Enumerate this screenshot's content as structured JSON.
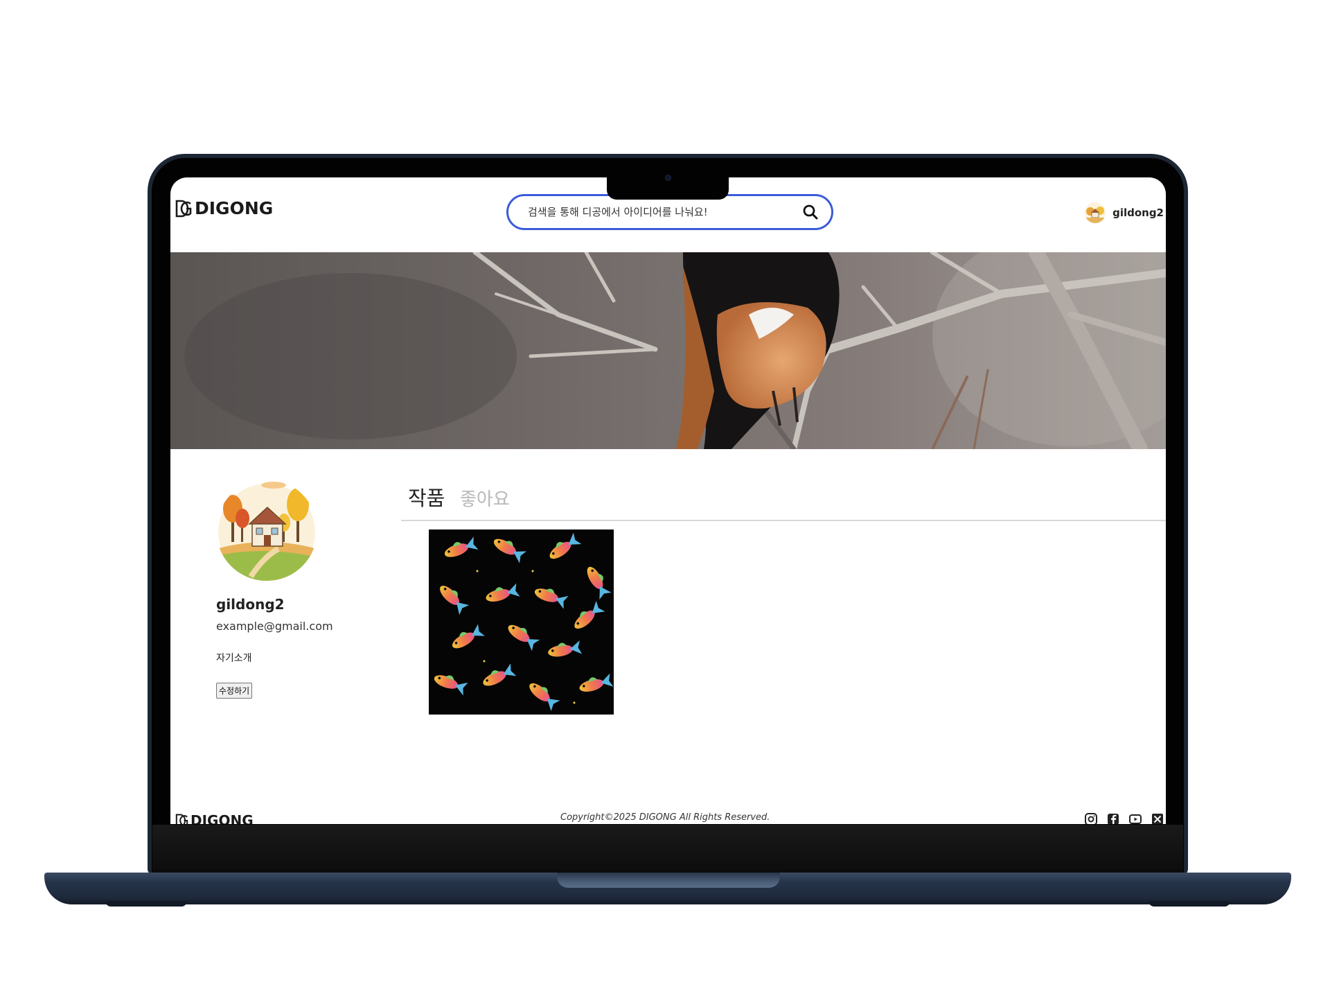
{
  "header": {
    "logo_text": "DIGONG",
    "search_placeholder": "검색을 통해 디공에서 아이디어를 나눠요!",
    "username": "gildong2"
  },
  "profile": {
    "name": "gildong2",
    "email": "example@gmail.com",
    "bio": "자기소개",
    "edit_label": "수정하기"
  },
  "tabs": [
    {
      "label": "작품",
      "active": true
    },
    {
      "label": "좋아요",
      "active": false
    }
  ],
  "footer": {
    "logo_text": "DIGONG",
    "copyright": "Copyright©2025 DIGONG All Rights Reserved.",
    "social_icons": [
      "instagram-icon",
      "facebook-icon",
      "youtube-icon",
      "x-icon"
    ]
  },
  "colors": {
    "search_border": "#3a5bd9",
    "tab_active": "#222222",
    "tab_inactive": "#b8b8b8",
    "laptop_body": "#1c2634"
  }
}
